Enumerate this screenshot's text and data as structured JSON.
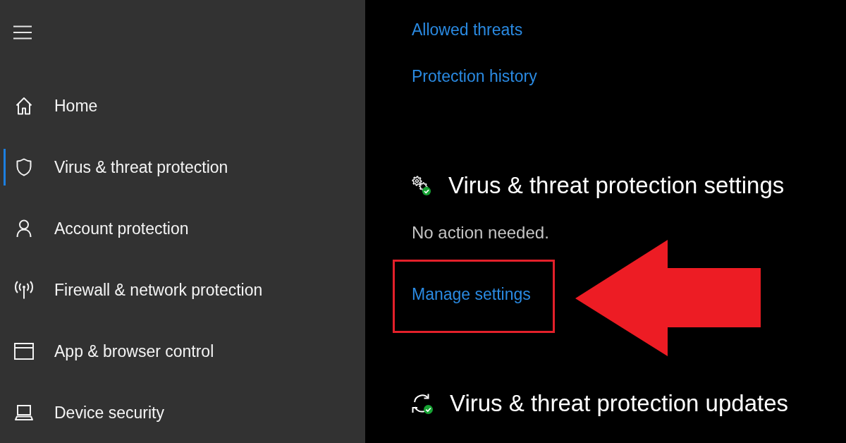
{
  "sidebar": {
    "items": [
      {
        "label": "Home",
        "selected": false
      },
      {
        "label": "Virus & threat protection",
        "selected": true
      },
      {
        "label": "Account protection",
        "selected": false
      },
      {
        "label": "Firewall & network protection",
        "selected": false
      },
      {
        "label": "App & browser control",
        "selected": false
      },
      {
        "label": "Device security",
        "selected": false
      }
    ]
  },
  "content": {
    "links": [
      {
        "label": "Allowed threats"
      },
      {
        "label": "Protection history"
      }
    ],
    "sections": [
      {
        "title": "Virus & threat protection settings",
        "status": "No action needed.",
        "link": {
          "label": "Manage settings",
          "highlighted": true
        }
      },
      {
        "title": "Virus & threat protection updates"
      }
    ]
  }
}
